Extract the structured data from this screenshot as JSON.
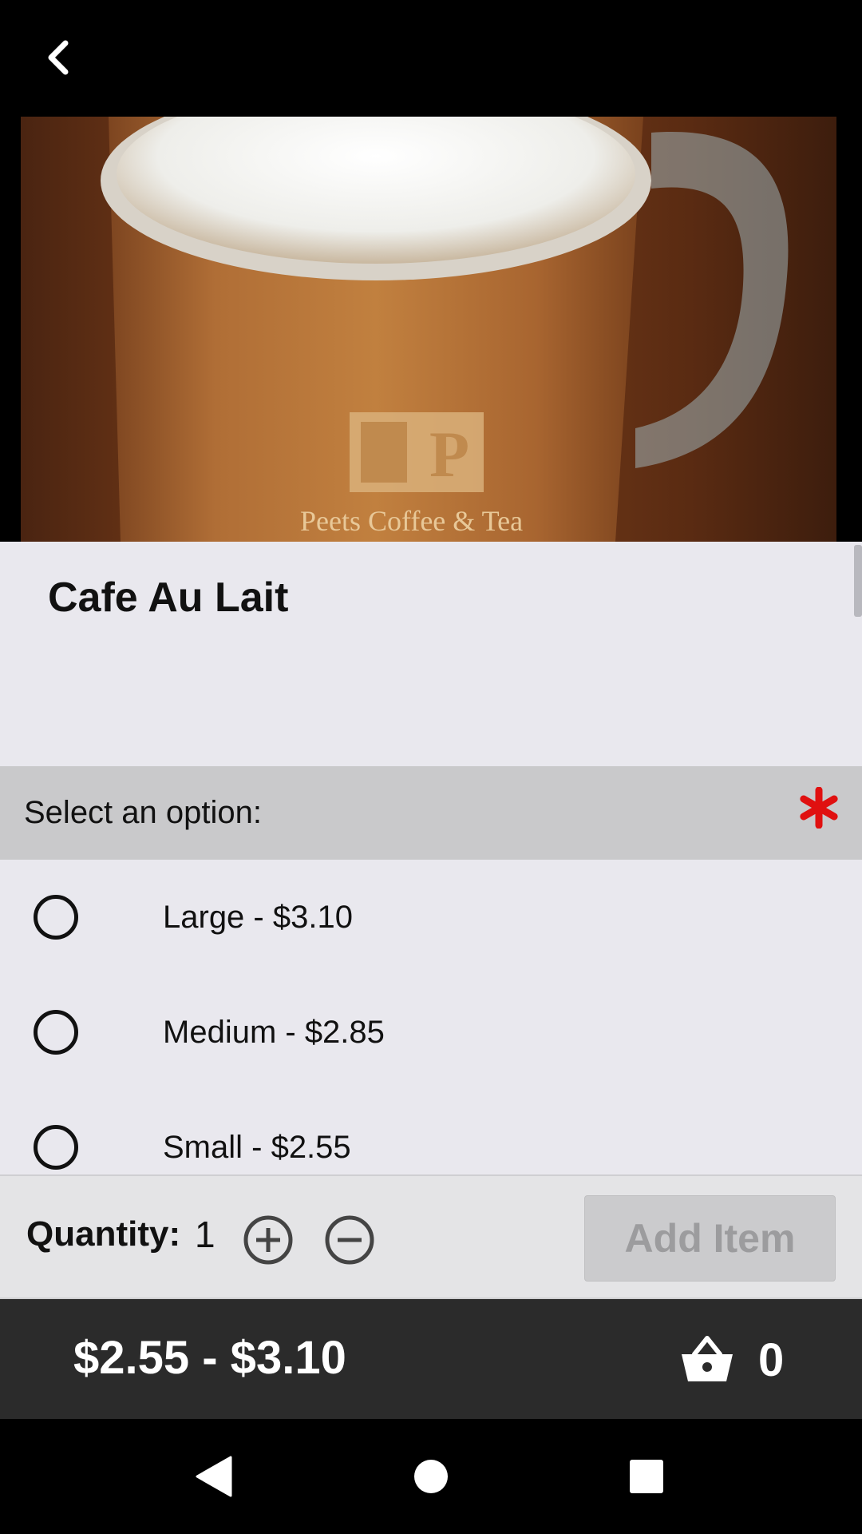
{
  "toolbar": {
    "back_icon": "chevron-left-icon"
  },
  "hero": {
    "brand_text": "Peets Coffee & Tea",
    "brand_letter": "P"
  },
  "item": {
    "title": "Cafe Au Lait"
  },
  "options": {
    "header": "Select an option:",
    "required_icon": "asterisk-icon",
    "required_color": "#e01010",
    "items": [
      {
        "label": "Large - $3.10",
        "selected": false
      },
      {
        "label": "Medium - $2.85",
        "selected": false
      },
      {
        "label": "Small - $2.55",
        "selected": false
      }
    ]
  },
  "quantity": {
    "label": "Quantity:",
    "value": "1",
    "increment_icon": "plus-circle-icon",
    "decrement_icon": "minus-circle-icon",
    "add_button_label": "Add Item",
    "add_button_enabled": false
  },
  "footer": {
    "price_range": "$2.55 - $3.10",
    "cart_icon": "basket-icon",
    "cart_count": "0"
  },
  "system_nav": {
    "back_icon": "triangle-back-icon",
    "home_icon": "circle-home-icon",
    "recents_icon": "square-recents-icon"
  }
}
